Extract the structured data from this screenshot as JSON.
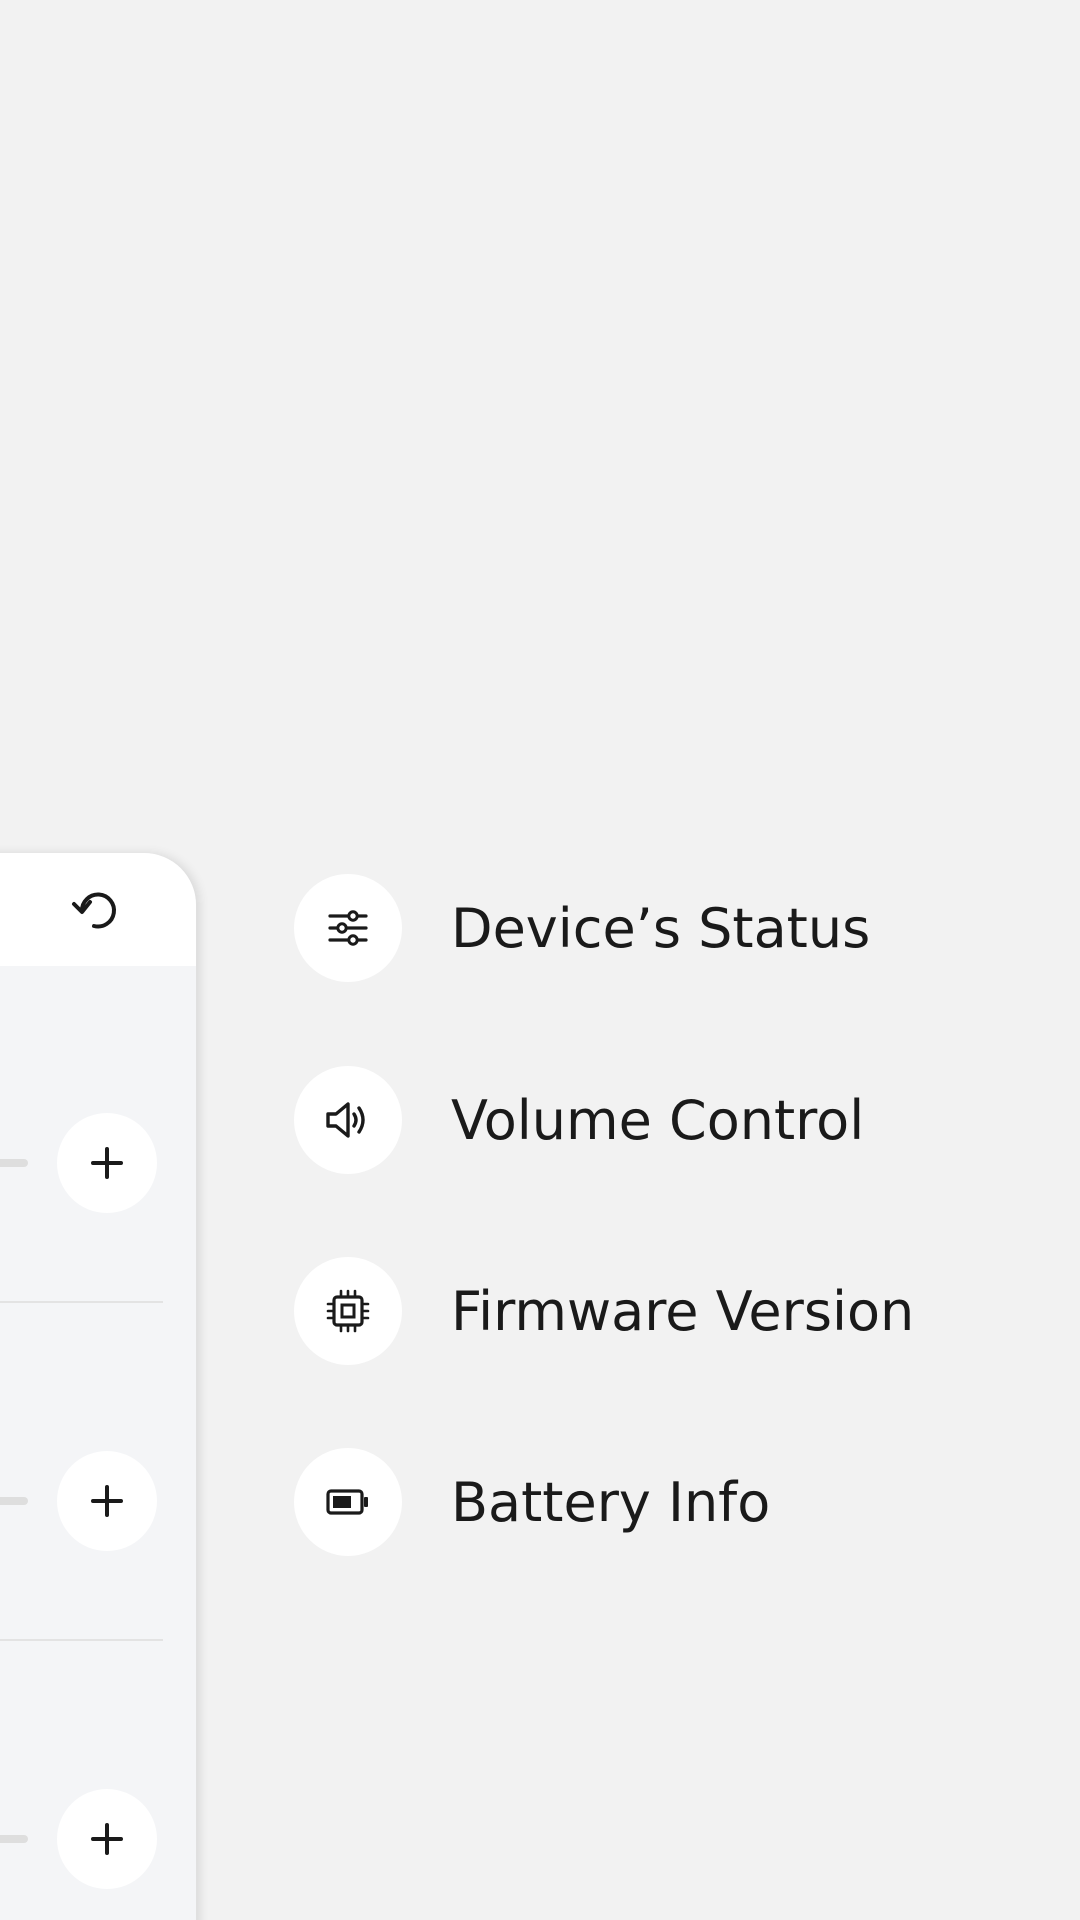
{
  "panel": {
    "reset_icon": "reset-icon",
    "rows": [
      {
        "add_icon": "plus-icon"
      },
      {
        "add_icon": "plus-icon"
      },
      {
        "add_icon": "plus-icon"
      }
    ]
  },
  "menu": {
    "items": [
      {
        "label": "Device’s Status",
        "icon": "sliders-icon"
      },
      {
        "label": "Volume Control",
        "icon": "volume-icon"
      },
      {
        "label": "Firmware Version",
        "icon": "chip-icon"
      },
      {
        "label": "Battery Info",
        "icon": "battery-icon"
      }
    ]
  },
  "colors": {
    "background": "#f2f2f2",
    "panel": "#f4f5f7",
    "text": "#1a1a1a",
    "icon_bg": "#ffffff"
  }
}
